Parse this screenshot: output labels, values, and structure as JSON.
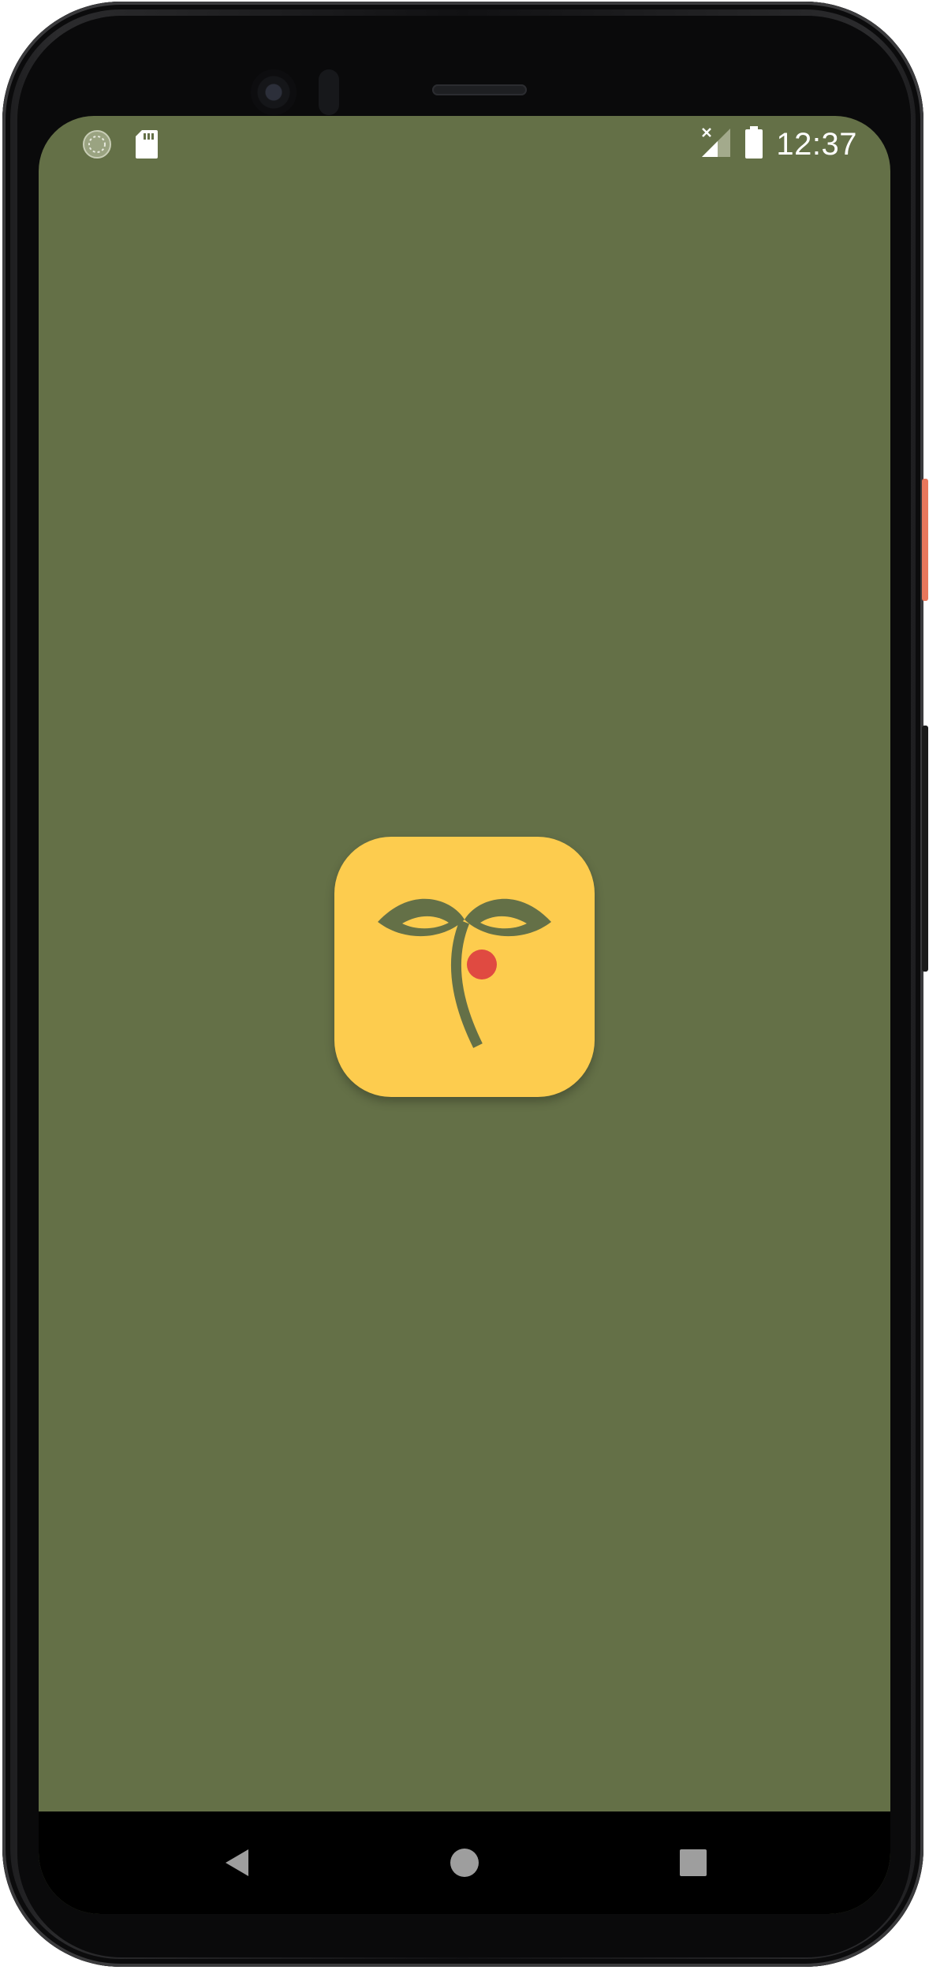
{
  "status_bar": {
    "time": "12:37",
    "left_icons": [
      "media-sync-icon",
      "sd-card-icon"
    ],
    "right_icons": [
      "signal-off-icon",
      "battery-icon"
    ]
  },
  "splash": {
    "background_color": "#647047",
    "logo": {
      "icon": "sprout-logo-icon",
      "tile_color": "#fdcc4e",
      "leaf_color": "#647047",
      "berry_color": "#e04a41"
    }
  },
  "navigation_bar": {
    "buttons": [
      "back-icon",
      "home-icon",
      "recents-icon"
    ]
  }
}
